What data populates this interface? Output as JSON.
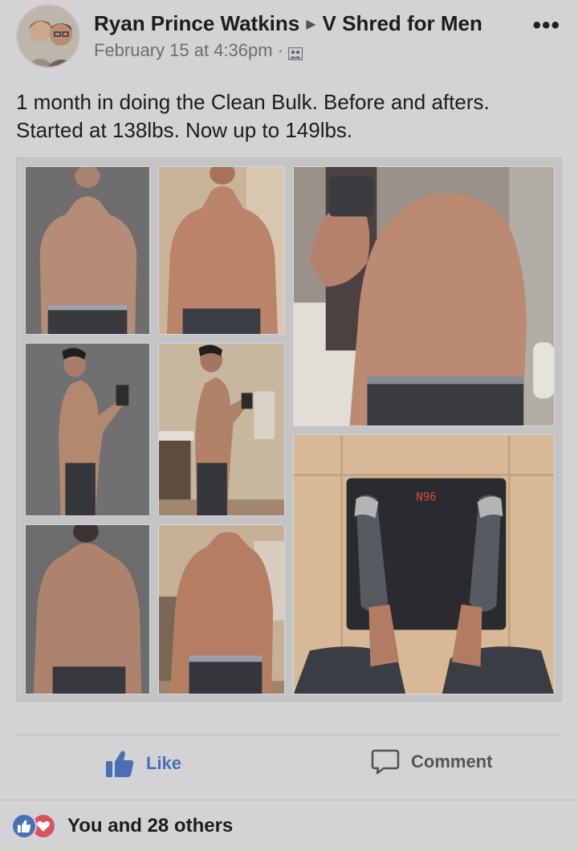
{
  "post": {
    "author": "Ryan Prince Watkins",
    "group": "V Shred for Men",
    "timestamp": "February 15 at 4:36pm",
    "separator": "·",
    "audience_icon": "group-icon",
    "more_label": "•••",
    "caption_line1": "1 month in doing the Clean Bulk. Before and afters.",
    "caption_line2": "Started at 138lbs. Now up to 149lbs."
  },
  "photos": [
    {
      "id": "before-front"
    },
    {
      "id": "after-front"
    },
    {
      "id": "after-front-closeup"
    },
    {
      "id": "before-side"
    },
    {
      "id": "after-side"
    },
    {
      "id": "scale"
    },
    {
      "id": "before-back"
    },
    {
      "id": "after-back"
    }
  ],
  "scale_reading": "N96",
  "actions": {
    "like_label": "Like",
    "comment_label": "Comment"
  },
  "reactions": {
    "summary": "You and 28 others",
    "icons": [
      "thumbs-up-icon",
      "heart-icon"
    ]
  },
  "colors": {
    "like_blue": "#4a6fb5",
    "heart_red": "#d9535e",
    "background": "#d3d3d6"
  }
}
